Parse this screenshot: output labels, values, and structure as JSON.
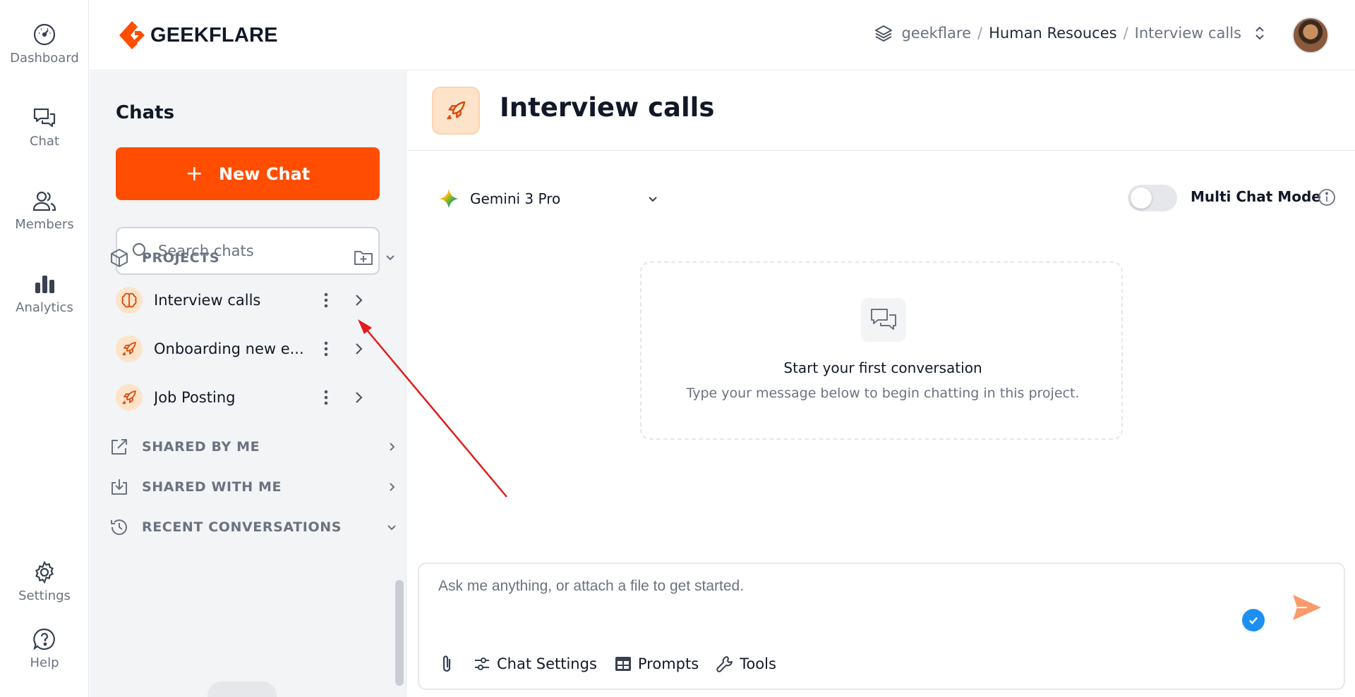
{
  "rail": {
    "items": [
      {
        "label": "Dashboard",
        "icon": "dashboard-icon"
      },
      {
        "label": "Chat",
        "icon": "chat-icon"
      },
      {
        "label": "Members",
        "icon": "members-icon"
      },
      {
        "label": "Analytics",
        "icon": "analytics-icon"
      },
      {
        "label": "Settings",
        "icon": "gear-icon"
      },
      {
        "label": "Help",
        "icon": "help-icon"
      }
    ]
  },
  "header": {
    "logo_text": "GEEKFLARE",
    "breadcrumb": {
      "workspace": "geekflare",
      "separator": "/",
      "team": "Human Resouces",
      "project": "Interview calls"
    }
  },
  "sidebar": {
    "title": "Chats",
    "new_chat_label": "New Chat",
    "new_chat_plus": "+",
    "search_placeholder": "Search chats",
    "projects_label": "PROJECTS",
    "projects": [
      {
        "label": "Interview calls",
        "icon": "brain-icon"
      },
      {
        "label": "Onboarding new e...",
        "icon": "rocket-icon"
      },
      {
        "label": "Job Posting",
        "icon": "rocket-icon"
      }
    ],
    "shared_by_me_label": "SHARED BY ME",
    "shared_with_me_label": "SHARED WITH ME",
    "recent_label": "RECENT CONVERSATIONS"
  },
  "main": {
    "title": "Interview calls",
    "model": "Gemini 3 Pro",
    "multi_chat_label": "Multi Chat Mode",
    "multi_chat_enabled": false,
    "empty_title": "Start your first conversation",
    "empty_subtitle": "Type your message below to begin chatting in this project.",
    "composer_placeholder": "Ask me anything, or attach a file to get started.",
    "tools": {
      "chat_settings": "Chat Settings",
      "prompts": "Prompts",
      "tools": "Tools"
    }
  },
  "colors": {
    "accent": "#ff4d01",
    "accent_soft": "#fde3c9",
    "annotation_arrow": "#e11d1d",
    "check_badge": "#1d8ff2",
    "send": "#fb9a6b"
  }
}
